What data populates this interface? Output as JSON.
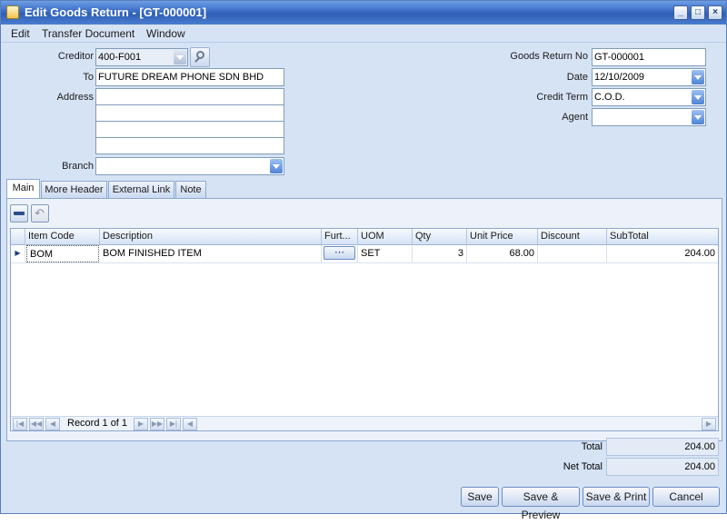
{
  "window": {
    "title": "Edit Goods Return - [GT-000001]"
  },
  "menu": [
    "Edit",
    "Transfer Document",
    "Window"
  ],
  "header": {
    "creditor_label": "Creditor",
    "creditor_value": "400-F001",
    "to_label": "To",
    "to_value": "FUTURE DREAM PHONE SDN BHD",
    "address_label": "Address",
    "branch_label": "Branch",
    "branch_value": "",
    "goods_return_no_label": "Goods Return No",
    "goods_return_no_value": "GT-000001",
    "date_label": "Date",
    "date_value": "12/10/2009",
    "credit_term_label": "Credit Term",
    "credit_term_value": "C.O.D.",
    "agent_label": "Agent",
    "agent_value": ""
  },
  "tabs": [
    "Main",
    "More Header",
    "External Link",
    "Note"
  ],
  "grid": {
    "columns": [
      "Item Code",
      "Description",
      "Furt...",
      "UOM",
      "Qty",
      "Unit Price",
      "Discount",
      "SubTotal"
    ],
    "rows": [
      {
        "item_code": "BOM",
        "description": "BOM FINISHED ITEM",
        "further": "⋯",
        "uom": "SET",
        "qty": "3",
        "unit_price": "68.00",
        "discount": "",
        "subtotal": "204.00"
      }
    ]
  },
  "navigator": {
    "record_text": "Record 1 of 1"
  },
  "totals": {
    "total_label": "Total",
    "total_value": "204.00",
    "net_total_label": "Net Total",
    "net_total_value": "204.00"
  },
  "buttons": {
    "save": "Save",
    "save_preview": "Save & Preview",
    "save_print": "Save & Print",
    "cancel": "Cancel"
  },
  "icons": {
    "app": "document-icon",
    "search": "search-icon",
    "delete_row": "remove-row-icon",
    "undo": "undo-icon"
  }
}
